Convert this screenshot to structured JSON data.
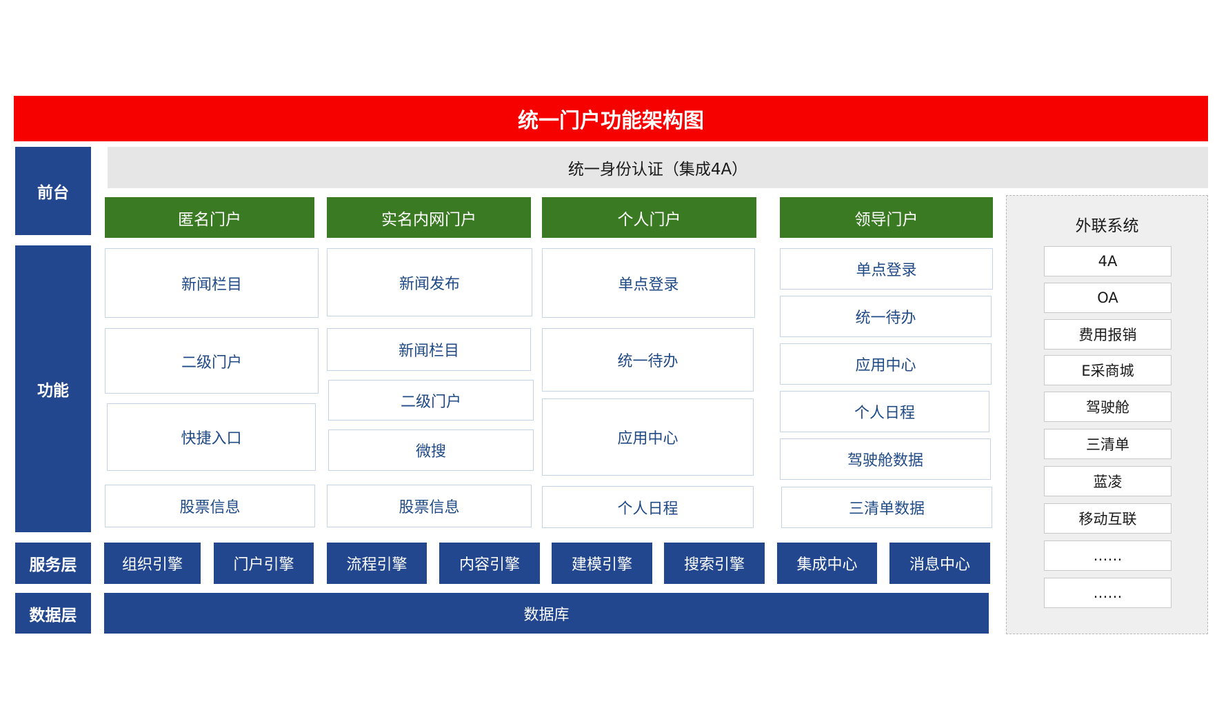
{
  "title": "统一门户功能架构图",
  "layers": {
    "front": "前台",
    "function": "功能",
    "service": "服务层",
    "data": "数据层"
  },
  "auth": "统一身份认证（集成4A）",
  "portals": [
    {
      "name": "匿名门户",
      "functions": [
        "新闻栏目",
        "二级门户",
        "快捷入口",
        "股票信息"
      ]
    },
    {
      "name": "实名内网门户",
      "functions": [
        "新闻发布",
        "新闻栏目",
        "二级门户",
        "微搜",
        "股票信息"
      ]
    },
    {
      "name": "个人门户",
      "functions": [
        "单点登录",
        "统一待办",
        "应用中心",
        "个人日程"
      ]
    },
    {
      "name": "领导门户",
      "functions": [
        "单点登录",
        "统一待办",
        "应用中心",
        "个人日程",
        "驾驶舱数据",
        "三清单数据"
      ]
    }
  ],
  "services": [
    "组织引擎",
    "门户引擎",
    "流程引擎",
    "内容引擎",
    "建模引擎",
    "搜索引擎",
    "集成中心",
    "消息中心"
  ],
  "database": "数据库",
  "external": {
    "title": "外联系统",
    "items": [
      "4A",
      "OA",
      "费用报销",
      "E采商城",
      "驾驶舱",
      "三清单",
      "蓝凌",
      "移动互联",
      "……",
      "……"
    ]
  },
  "colors": {
    "title_bar": "#f70000",
    "layer_blue": "#22478e",
    "portal_green": "#3a7a22",
    "auth_gray": "#e6e6e6",
    "function_text": "#1f4a86"
  }
}
